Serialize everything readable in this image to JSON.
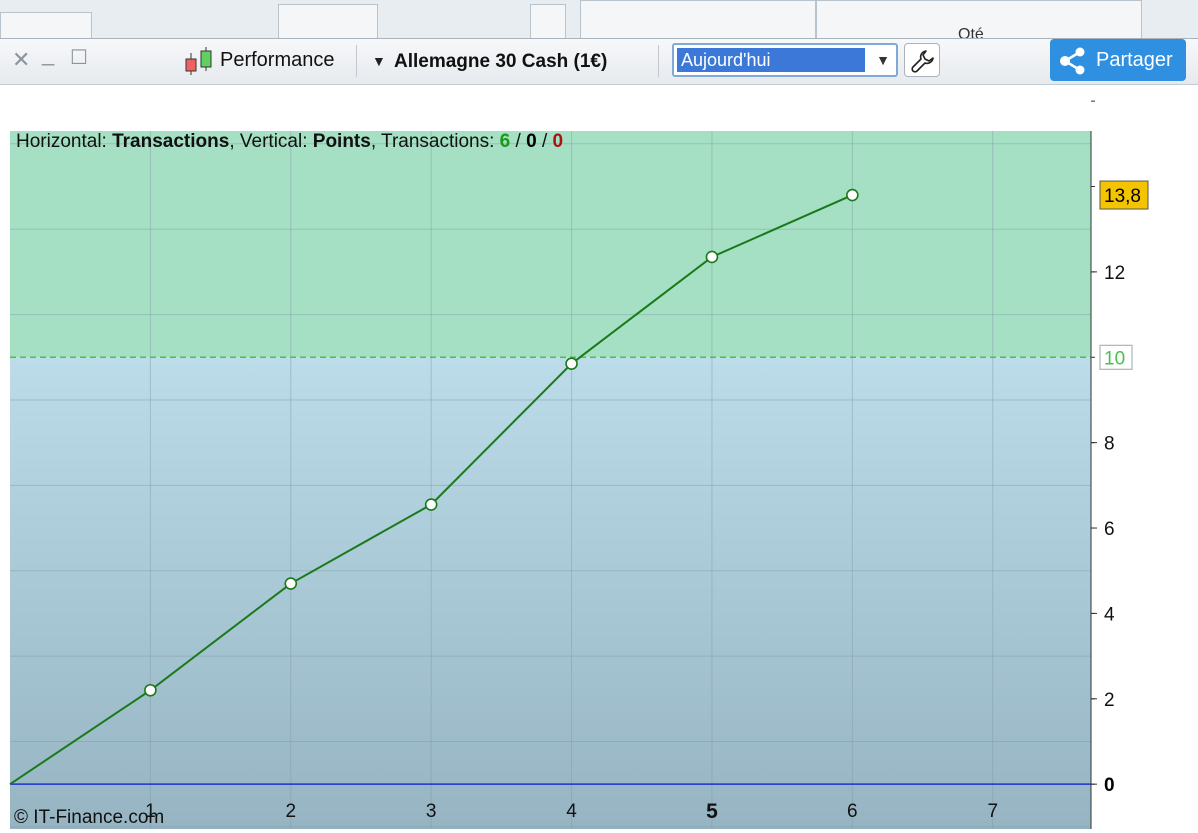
{
  "toolbar": {
    "close_glyph": "✕",
    "minimize_glyph": "_",
    "maximize_glyph": "☐",
    "performance_label": "Performance",
    "instrument_label": "Allemagne 30 Cash (1€)",
    "period_selected": "Aujourd'hui",
    "share_label": "Partager"
  },
  "background": {
    "partial_text": "Qté"
  },
  "info_line": {
    "horizontal_label": "Horizontal:",
    "horizontal_value": "Transactions",
    "vertical_label": "Vertical:",
    "vertical_value": "Points",
    "transactions_label": "Transactions:",
    "tx_winning": "6",
    "tx_neutral": "0",
    "tx_losing": "0",
    "slash": "/"
  },
  "copyright": "© IT-Finance.com",
  "chart_data": {
    "type": "line",
    "xlabel": "",
    "ylabel": "",
    "x_ticks": [
      "1",
      "2",
      "3",
      "4",
      "5",
      "6",
      "7"
    ],
    "y_ticks": [
      "0",
      "2",
      "4",
      "6",
      "8",
      "12"
    ],
    "x": [
      0,
      1,
      2,
      3,
      4,
      5,
      6
    ],
    "series": [
      {
        "values": [
          0,
          2.2,
          4.7,
          6.55,
          9.85,
          12.35,
          13.8
        ]
      }
    ],
    "xlim": [
      0,
      7.7
    ],
    "ylim": [
      -1.05,
      15.3
    ],
    "threshold_value": 10,
    "threshold_label": "10",
    "last_value_label": "13,8",
    "zero_label": "0",
    "grid": true,
    "colors": {
      "line": "#1a7a1a",
      "threshold": "#4cc04c",
      "zero_line": "#2030d0",
      "above_threshold_fill": "#a6e0c4",
      "below_top": "#bcdcea",
      "below_bottom": "#96b4c2",
      "last_value_bg": "#f5c400",
      "tx_winning": "#1a9a1a",
      "tx_neutral": "#000000",
      "tx_losing": "#b01010",
      "share_button": "#2f8fe0",
      "period_highlight": "#3b78d8"
    }
  }
}
